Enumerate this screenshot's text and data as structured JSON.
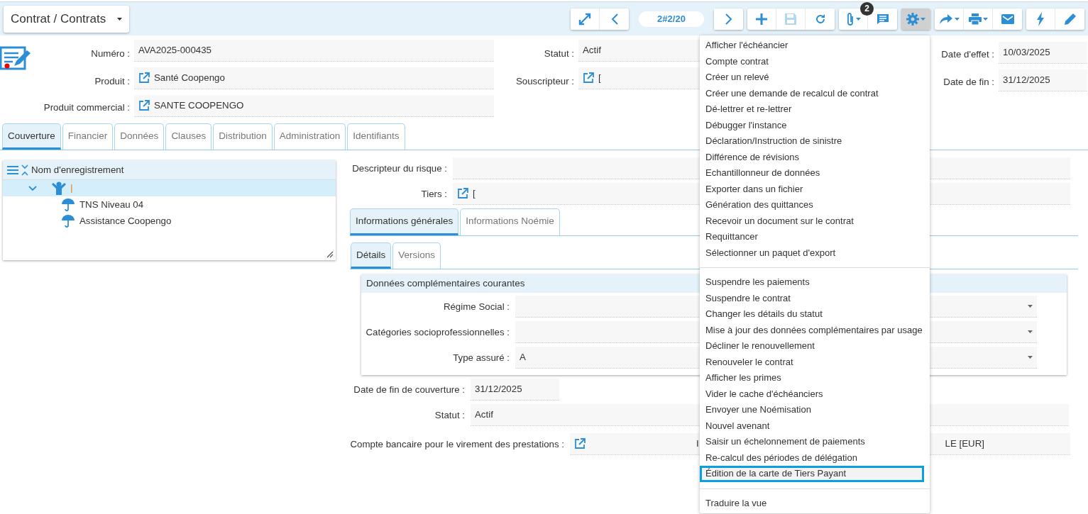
{
  "module_button": {
    "label": "Contrat / Contrats"
  },
  "toolbar": {
    "groups": [
      [
        {
          "kind": "expand"
        },
        {
          "kind": "previous"
        }
      ],
      [
        {
          "kind": "pager",
          "label": "2#2/20"
        }
      ],
      [
        {
          "kind": "next"
        }
      ],
      [
        {
          "kind": "add"
        },
        {
          "kind": "save",
          "disabled": true
        },
        {
          "kind": "refresh"
        }
      ],
      [
        {
          "kind": "attachment",
          "badge": "2",
          "caret": true
        },
        {
          "kind": "comment"
        }
      ],
      [
        {
          "kind": "settings",
          "caret": true,
          "active": true
        }
      ],
      [
        {
          "kind": "share",
          "caret": true
        },
        {
          "kind": "print",
          "caret": true
        },
        {
          "kind": "email"
        }
      ],
      [
        {
          "kind": "action"
        },
        {
          "kind": "edit"
        }
      ]
    ]
  },
  "header": {
    "left": [
      {
        "label": "Numéro :",
        "value": "AVA2025-000435",
        "link": false
      },
      {
        "label": "Produit :",
        "value": "Santé Coopengo",
        "link": true
      },
      {
        "label": "Produit commercial :",
        "value": "SANTE COOPENGO",
        "link": true
      }
    ],
    "middle": [
      {
        "label": "Statut :",
        "value": "Actif",
        "link": false
      },
      {
        "label": "Souscripteur :",
        "value": "[",
        "link": true
      }
    ],
    "right": [
      {
        "label": "Date d'effet :",
        "value": "10/03/2025"
      },
      {
        "label": "Date de fin :",
        "value": "31/12/2025"
      }
    ]
  },
  "tabs": [
    {
      "label": "Couverture",
      "selected": true
    },
    {
      "label": "Financier",
      "selected": false
    },
    {
      "label": "Données",
      "selected": false
    },
    {
      "label": "Clauses",
      "selected": false
    },
    {
      "label": "Distribution",
      "selected": false
    },
    {
      "label": "Administration",
      "selected": false
    },
    {
      "label": "Identifiants",
      "selected": false
    }
  ],
  "tree": {
    "column": "Nom d'enregistrement",
    "rows": [
      {
        "kind": "person",
        "selected": true,
        "expanded": true,
        "children": [
          {
            "kind": "umbrella",
            "label": "TNS Niveau 04",
            "selected": false
          },
          {
            "kind": "umbrella",
            "label": "Assistance Coopengo",
            "selected": false
          }
        ]
      }
    ]
  },
  "detail": {
    "risk_descriptor": {
      "label": "Descripteur du risque :"
    },
    "party": {
      "label": "Tiers :",
      "value": "[",
      "link": true
    },
    "tabs": [
      {
        "label": "Informations générales",
        "selected": true
      },
      {
        "label": "Informations Noémie",
        "selected": false
      }
    ],
    "subtabs": [
      {
        "label": "Détails",
        "selected": true
      },
      {
        "label": "Versions",
        "selected": false
      }
    ],
    "card": {
      "title": "Données complémentaires courantes",
      "fields": [
        {
          "label": "Régime Social :"
        },
        {
          "label": "Catégories socioprofessionnelles :"
        },
        {
          "label": "Type assuré :",
          "value": "A"
        }
      ]
    },
    "coverage_end": {
      "label": "Date de fin de couverture :",
      "value": "31/12/2025"
    },
    "status": {
      "label": "Statut :",
      "value": "Actif"
    },
    "bank_account": {
      "label": "Compte bancaire pour le virement des prestations :",
      "value": "I",
      "fragment": "LE [EUR]",
      "link": true
    }
  },
  "menu": {
    "groups": [
      [
        {
          "label": "Afficher l'échéancier",
          "highlighted": false
        },
        {
          "label": "Compte contrat",
          "highlighted": false
        },
        {
          "label": "Créer un relevé",
          "highlighted": false
        },
        {
          "label": "Créer une demande de recalcul de contrat",
          "highlighted": false
        },
        {
          "label": "Dé-lettrer et re-lettrer",
          "highlighted": false
        },
        {
          "label": "Débugger l'instance",
          "highlighted": false
        },
        {
          "label": "Déclaration/Instruction de sinistre",
          "highlighted": false
        },
        {
          "label": "Différence de révisions",
          "highlighted": false
        },
        {
          "label": "Echantillonneur de données",
          "highlighted": false
        },
        {
          "label": "Exporter dans un fichier",
          "highlighted": false
        },
        {
          "label": "Génération des quittances",
          "highlighted": false
        },
        {
          "label": "Recevoir un document sur le contrat",
          "highlighted": false
        },
        {
          "label": "Requittancer",
          "highlighted": false
        },
        {
          "label": "Sélectionner un paquet d'export",
          "highlighted": false
        }
      ],
      [
        {
          "label": "Suspendre les paiements",
          "highlighted": false
        },
        {
          "label": "Suspendre le contrat",
          "highlighted": false
        },
        {
          "label": "Changer les détails du statut",
          "highlighted": false
        },
        {
          "label": "Mise à jour des données complémentaires par usage",
          "highlighted": false
        },
        {
          "label": "Décliner le renouvellement",
          "highlighted": false
        },
        {
          "label": "Renouveler le contrat",
          "highlighted": false
        },
        {
          "label": "Afficher les primes",
          "highlighted": false
        },
        {
          "label": "Vider le cache d'échéanciers",
          "highlighted": false
        },
        {
          "label": "Envoyer une Noémisation",
          "highlighted": false
        },
        {
          "label": "Nouvel avenant",
          "highlighted": false
        },
        {
          "label": "Saisir un échelonnement de paiements",
          "highlighted": false
        },
        {
          "label": "Re-calcul des périodes de délégation",
          "highlighted": false
        },
        {
          "label": "Édition de la carte de Tiers Payant",
          "highlighted": true
        }
      ],
      [
        {
          "label": "Traduire la vue",
          "highlighted": false
        }
      ]
    ]
  }
}
